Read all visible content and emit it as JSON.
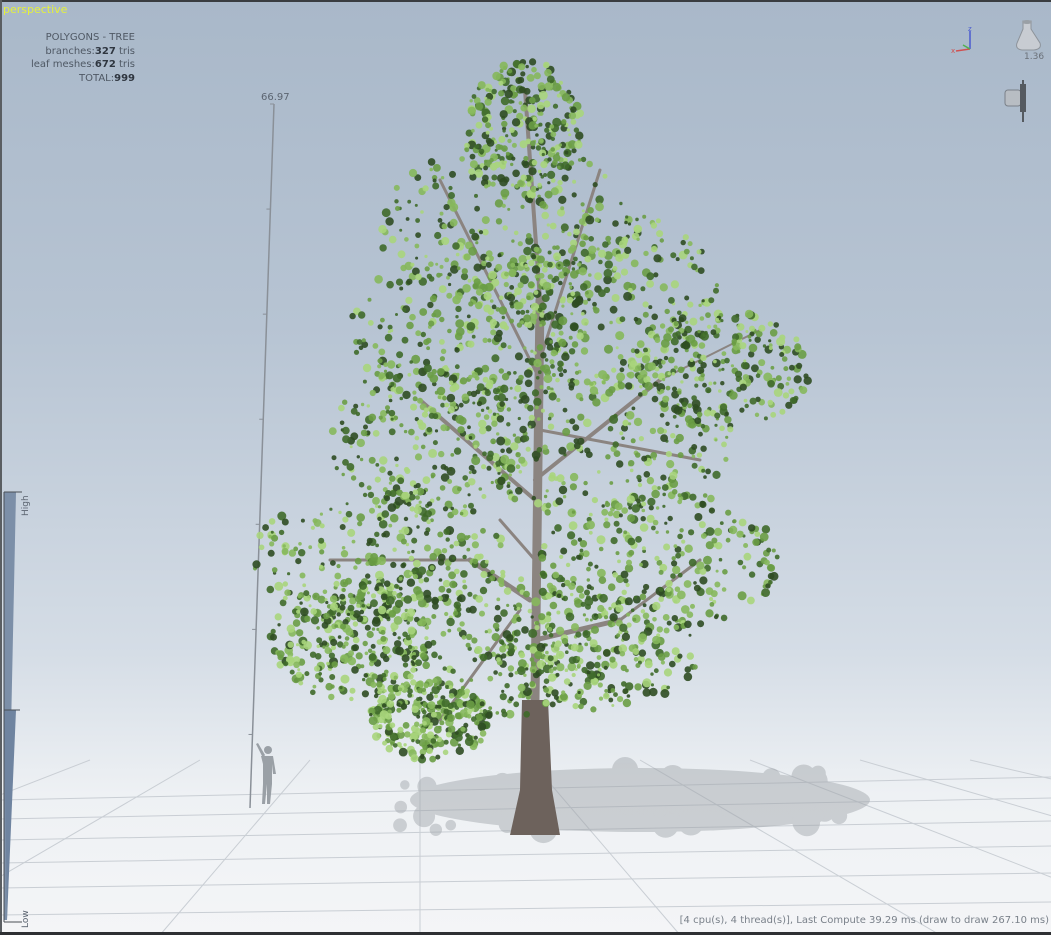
{
  "viewport": {
    "view_label": "perspective"
  },
  "stats": {
    "title": "POLYGONS - TREE",
    "branches_label": "branches:",
    "branches_value": "327",
    "leaf_label": "leaf meshes:",
    "leaf_value": "672",
    "tris_unit": "tris",
    "total_label": "TOTAL:",
    "total_value": "999"
  },
  "ruler": {
    "height_value": "66.97"
  },
  "lod_slider": {
    "high_label": "High",
    "low_label": "Low"
  },
  "nav": {
    "zoom_value": "1.36",
    "axis_icon": "axis-gizmo-icon",
    "zoom_icon": "zoom-flask-icon",
    "camera_icon": "camera-icon"
  },
  "status": {
    "text": "[4 cpu(s), 4 thread(s)], Last Compute 39.29 ms (draw to draw 267.10 ms)"
  },
  "colors": {
    "leaf_dark": "#3f6a2a",
    "leaf_mid": "#6a9d45",
    "leaf_light": "#a8d57c",
    "trunk": "#6d625c"
  }
}
